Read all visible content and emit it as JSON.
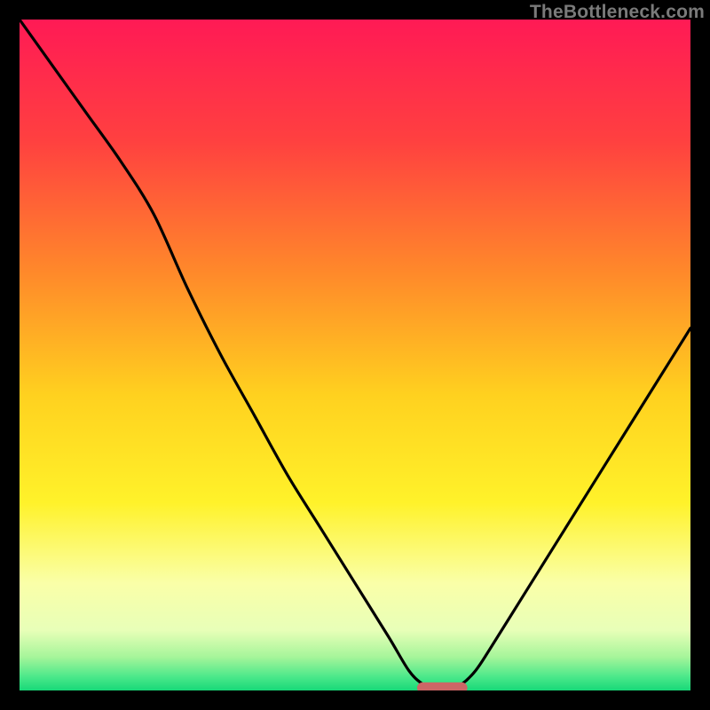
{
  "attribution": "TheBottleneck.com",
  "chart_data": {
    "type": "line",
    "title": "",
    "xlabel": "",
    "ylabel": "",
    "xlim": [
      0,
      100
    ],
    "ylim": [
      0,
      100
    ],
    "grid": false,
    "legend": false,
    "background": "rainbow-vertical-gradient",
    "series": [
      {
        "name": "bottleneck-curve",
        "x": [
          0,
          5,
          10,
          15,
          20,
          25,
          30,
          35,
          40,
          45,
          50,
          55,
          58,
          60,
          62,
          64,
          66,
          68,
          70,
          75,
          80,
          85,
          90,
          95,
          100
        ],
        "values": [
          100,
          93,
          86,
          79,
          71,
          60,
          50,
          41,
          32,
          24,
          16,
          8,
          3,
          1,
          0,
          0,
          1,
          3,
          6,
          14,
          22,
          30,
          38,
          46,
          54
        ]
      }
    ],
    "marker": {
      "name": "optimal-region",
      "shape": "pill",
      "center_x": 63,
      "center_y": 0.4,
      "width": 7.5,
      "height": 1.6,
      "color": "#cc6666"
    },
    "gradient_stops": [
      {
        "offset": 0,
        "color": "#ff1a55"
      },
      {
        "offset": 18,
        "color": "#ff4040"
      },
      {
        "offset": 38,
        "color": "#ff8a2a"
      },
      {
        "offset": 56,
        "color": "#ffd11f"
      },
      {
        "offset": 72,
        "color": "#fff22a"
      },
      {
        "offset": 84,
        "color": "#faffa8"
      },
      {
        "offset": 91,
        "color": "#e8ffb8"
      },
      {
        "offset": 95,
        "color": "#a6f59a"
      },
      {
        "offset": 98,
        "color": "#4ae88a"
      },
      {
        "offset": 100,
        "color": "#18d878"
      }
    ]
  }
}
